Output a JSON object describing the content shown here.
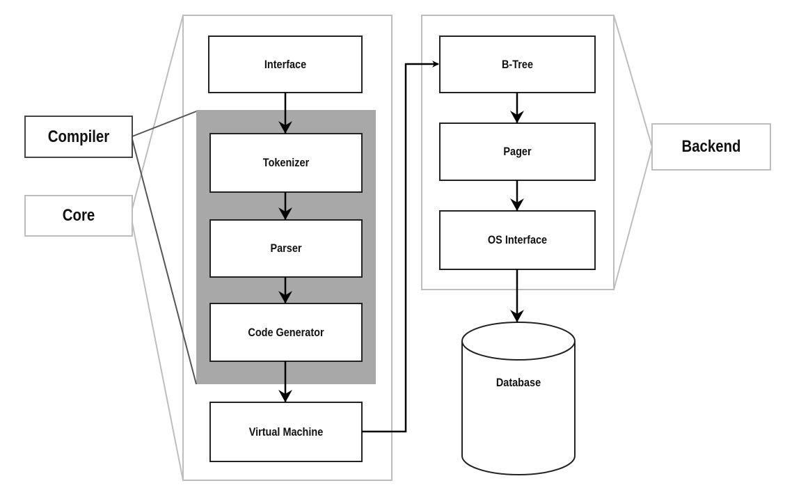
{
  "side_labels": {
    "compiler": "Compiler",
    "core": "Core",
    "backend": "Backend"
  },
  "core_modules": {
    "interface": "Interface",
    "tokenizer": "Tokenizer",
    "parser": "Parser",
    "code_generator": "Code Generator",
    "virtual_machine": "Virtual Machine"
  },
  "backend_modules": {
    "btree": "B-Tree",
    "pager": "Pager",
    "os_interface": "OS Interface"
  },
  "storage": {
    "database": "Database"
  },
  "colors": {
    "panel_border": "#bdbdbd",
    "compiler_shade": "#a8a8a8",
    "box_border": "#222222"
  }
}
